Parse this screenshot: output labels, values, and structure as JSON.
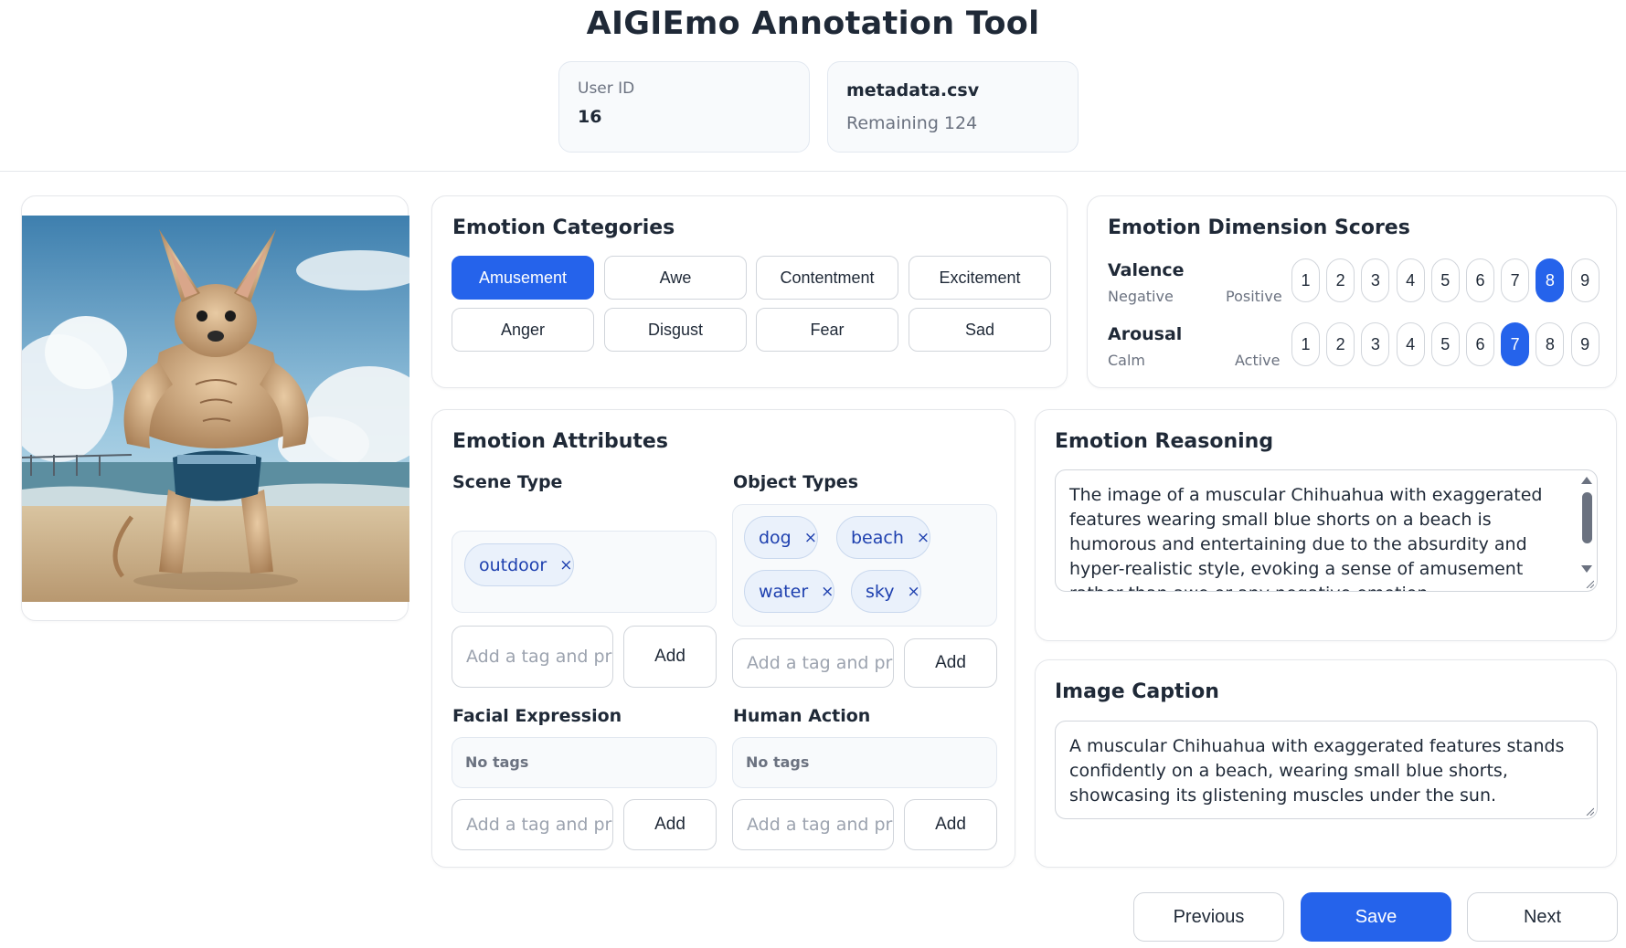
{
  "app": {
    "title": "AIGIEmo Annotation Tool"
  },
  "user": {
    "label": "User ID",
    "value": "16"
  },
  "file": {
    "name": "metadata.csv",
    "remaining": "Remaining 124"
  },
  "image": {
    "icon": "muscular-chihuahua-beach-image"
  },
  "categories": {
    "title": "Emotion Categories",
    "items": [
      "Amusement",
      "Awe",
      "Contentment",
      "Excitement",
      "Anger",
      "Disgust",
      "Fear",
      "Sad"
    ],
    "selected": "Amusement"
  },
  "dimensions": {
    "title": "Emotion Dimension Scores",
    "scale": [
      "1",
      "2",
      "3",
      "4",
      "5",
      "6",
      "7",
      "8",
      "9"
    ],
    "valence": {
      "label": "Valence",
      "low": "Negative",
      "high": "Positive",
      "selected": 8
    },
    "arousal": {
      "label": "Arousal",
      "low": "Calm",
      "high": "Active",
      "selected": 7
    }
  },
  "attributes": {
    "title": "Emotion Attributes",
    "placeholder": "Add a tag and press Enter",
    "add_label": "Add",
    "no_tags": "No tags",
    "scene": {
      "label": "Scene Type",
      "tags": [
        "outdoor"
      ]
    },
    "objects": {
      "label": "Object Types",
      "tags": [
        "dog",
        "beach",
        "water",
        "sky"
      ]
    },
    "facial": {
      "label": "Facial Expression",
      "tags": []
    },
    "action": {
      "label": "Human Action",
      "tags": []
    },
    "remove_glyph": "×"
  },
  "reasoning": {
    "title": "Emotion Reasoning",
    "text": "The image of a muscular Chihuahua with exaggerated features wearing small blue shorts on a beach is humorous and entertaining due to the absurdity and hyper-realistic style, evoking a sense of amusement rather than awe or any negative emotion."
  },
  "caption": {
    "title": "Image Caption",
    "text": "A muscular Chihuahua with exaggerated features stands confidently on a beach, wearing small blue shorts, showcasing its glistening muscles under the sun."
  },
  "nav": {
    "previous": "Previous",
    "save": "Save",
    "next": "Next"
  },
  "colors": {
    "accent": "#2563eb",
    "tag_bg": "#eaf1fb",
    "tag_text": "#1e40af"
  }
}
